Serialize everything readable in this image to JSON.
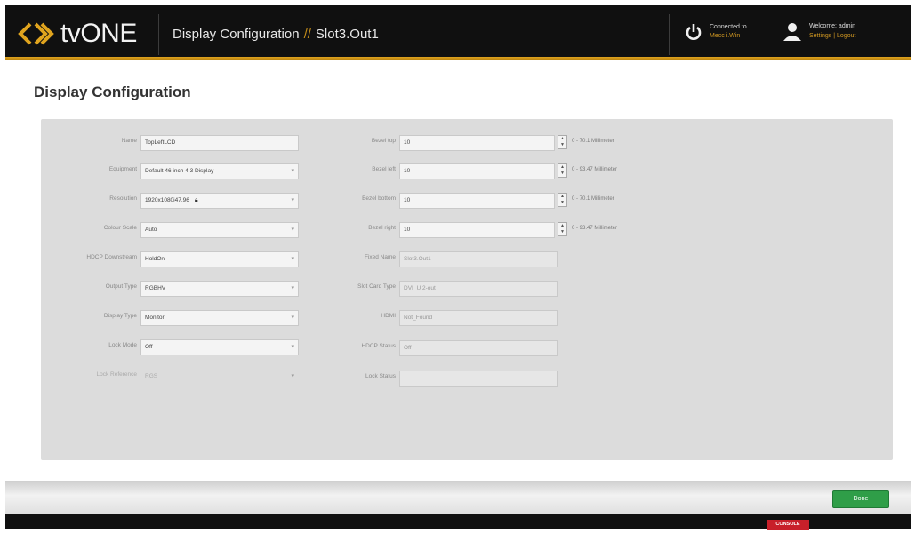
{
  "header": {
    "brand": "tvONE",
    "section": "Display Configuration",
    "separator": "//",
    "target": "Slot3.Out1",
    "connection": {
      "label": "Connected to",
      "host": "Mecc i.Win"
    },
    "user": {
      "welcome": "Welcome: admin",
      "settings": "Settings",
      "sep": "|",
      "logout": "Logout"
    }
  },
  "page": {
    "title": "Display Configuration"
  },
  "left_fields": {
    "name": {
      "label": "Name",
      "value": "TopLeftLCD"
    },
    "equipment": {
      "label": "Equipment",
      "value": "Default 46 inch 4:3 Display"
    },
    "resolution": {
      "label": "Resolution",
      "value": "1920x1080i47.96"
    },
    "colour_scale": {
      "label": "Colour Scale",
      "value": "Auto"
    },
    "hdcp_downstream": {
      "label": "HDCP Downstream",
      "value": "HoldOn"
    },
    "output_type": {
      "label": "Output Type",
      "value": "RGBHV"
    },
    "display_type": {
      "label": "Display Type",
      "value": "Monitor"
    },
    "lock_mode": {
      "label": "Lock Mode",
      "value": "Off"
    },
    "lock_reference": {
      "label": "Lock Reference",
      "value": "RGS"
    }
  },
  "right_fields": {
    "bezel_top": {
      "label": "Bezel top",
      "value": "10",
      "range": "0 - 70.1 Millimeter"
    },
    "bezel_left": {
      "label": "Bezel left",
      "value": "10",
      "range": "0 - 93.47 Millimeter"
    },
    "bezel_bottom": {
      "label": "Bezel bottom",
      "value": "10",
      "range": "0 - 70.1 Millimeter"
    },
    "bezel_right": {
      "label": "Bezel right",
      "value": "10",
      "range": "0 - 93.47 Millimeter"
    },
    "fixed_name": {
      "label": "Fixed Name",
      "value": "Slot3.Out1"
    },
    "slot_card_type": {
      "label": "Slot Card Type",
      "value": "DVI_U 2-out"
    },
    "hdmi": {
      "label": "HDMI",
      "value": "Not_Found"
    },
    "hdcp_status": {
      "label": "HDCP Status",
      "value": "Off"
    },
    "lock_status": {
      "label": "Lock Status",
      "value": ""
    }
  },
  "footer": {
    "done": "Done",
    "console": "CONSOLE"
  },
  "colors": {
    "accent": "#e0a41e",
    "header_bg": "#101010",
    "done_green": "#2f9e48",
    "console_red": "#c8202a",
    "panel_bg": "#dcdcdc"
  }
}
